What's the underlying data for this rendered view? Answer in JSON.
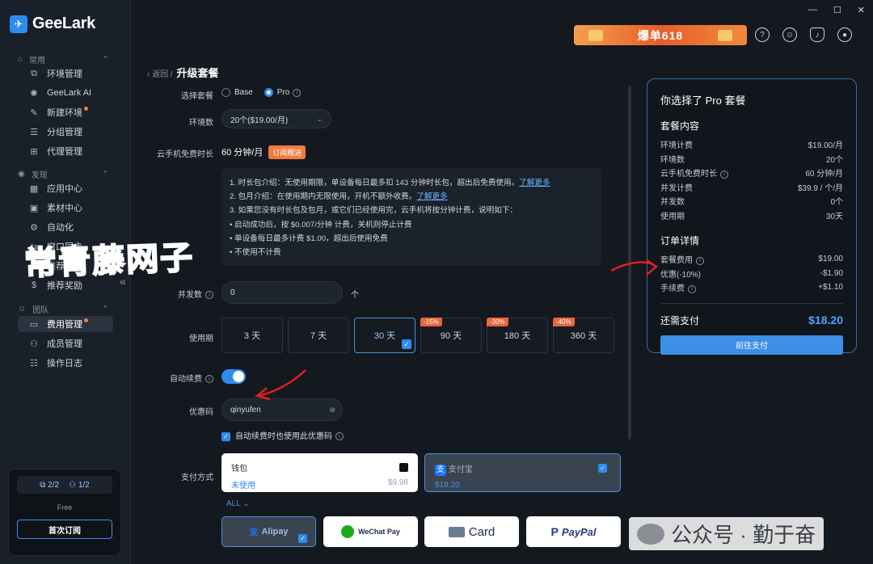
{
  "app": {
    "name": "GeeLark"
  },
  "window_controls": [
    "—",
    "☐",
    "✕"
  ],
  "promo": {
    "text": "爆单618"
  },
  "sidebar": {
    "sections": [
      {
        "label": "常用"
      },
      {
        "label": "发现"
      },
      {
        "label": "团队"
      }
    ],
    "items": [
      {
        "label": "环境管理"
      },
      {
        "label": "GeeLark AI"
      },
      {
        "label": "新建环境"
      },
      {
        "label": "分组管理"
      },
      {
        "label": "代理管理"
      },
      {
        "label": "应用中心"
      },
      {
        "label": "素材中心"
      },
      {
        "label": "自动化"
      },
      {
        "label": "窗口同步"
      },
      {
        "label": "推荐奖励"
      },
      {
        "label": "费用管理"
      },
      {
        "label": "成员管理"
      },
      {
        "label": "操作日志"
      }
    ],
    "usage": {
      "envs": "2/2",
      "members": "1/2",
      "plan": "Free",
      "button": "首次订阅"
    }
  },
  "breadcrumb": {
    "back": "返回 /",
    "title": "升级套餐"
  },
  "form": {
    "plan_label": "选择套餐",
    "plan_options": [
      "Base",
      "Pro"
    ],
    "env_label": "环境数",
    "env_value": "20个($19.00/月)",
    "cloud_label": "云手机免费时长",
    "cloud_value": "60 分钟/月",
    "cloud_tag": "订阅赠送",
    "info_lines": [
      "1. 时长包介绍：无使用期限，单设备每日最多扣 143 分钟时长包，超出后免费使用。",
      "2. 包月介绍：在使用期内无限使用，开机不额外收费。",
      "3. 如果您没有时长包及包月，或它们已经使用完，云手机将按分钟计费，说明如下：",
      "• 启动成功后，按 $0.007/分钟 计费，关机则停止计费",
      "• 单设备每日最多计费 $1.00，超出后使用免费",
      "• 不使用不计费"
    ],
    "learn_more_1": "了解更多",
    "learn_more_2": "了解更多",
    "concurrency_label": "并发数",
    "concurrency_value": "0",
    "concurrency_unit": "个",
    "period_label": "使用期",
    "periods": [
      {
        "label": "3 天",
        "badge": ""
      },
      {
        "label": "7 天",
        "badge": ""
      },
      {
        "label": "30 天",
        "badge": ""
      },
      {
        "label": "90 天",
        "badge": "-15%"
      },
      {
        "label": "180 天",
        "badge": "-30%"
      },
      {
        "label": "360 天",
        "badge": "-40%"
      }
    ],
    "autorenew_label": "自动续费",
    "coupon_label": "优惠码",
    "coupon_value": "qinyufen",
    "coupon_check": "自动续费时也使用此优惠码",
    "payment_label": "支付方式",
    "wallet": {
      "title": "钱包",
      "status": "未使用",
      "amount": "$9.98"
    },
    "alipay_card": {
      "title": "支付宝",
      "amount": "$18.20"
    },
    "all_toggle": "ALL",
    "methods": [
      "Alipay",
      "WeChat Pay",
      "Card",
      "PayPal"
    ]
  },
  "summary": {
    "title": "你选择了 Pro 套餐",
    "content_title": "套餐内容",
    "content_rows": [
      {
        "k": "环境计费",
        "v": "$19.00/月"
      },
      {
        "k": "环境数",
        "v": "20个"
      },
      {
        "k": "云手机免费时长",
        "v": "60 分钟/月"
      },
      {
        "k": "并发计费",
        "v": "$39.9 / 个/月"
      },
      {
        "k": "并发数",
        "v": "0个"
      },
      {
        "k": "使用期",
        "v": "30天"
      }
    ],
    "order_title": "订单详情",
    "order_rows": [
      {
        "k": "套餐费用",
        "v": "$19.00"
      },
      {
        "k": "优惠(-10%)",
        "v": "-$1.90"
      },
      {
        "k": "手续费",
        "v": "+$1.10"
      }
    ],
    "total_label": "还需支付",
    "total_value": "$18.20",
    "pay_button": "前往支付"
  },
  "overlays": {
    "watermark": "常青藤网子",
    "wechat": "公众号 · 勤于奋"
  }
}
